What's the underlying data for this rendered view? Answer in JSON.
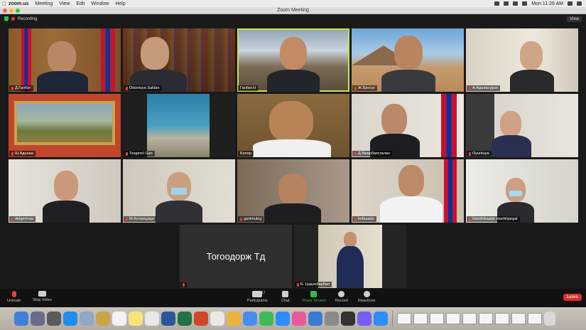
{
  "menubar": {
    "app": "zoom.us",
    "items": [
      "Meeting",
      "View",
      "Edit",
      "Window",
      "Help"
    ],
    "clock": "Mon 11:26 AM"
  },
  "window": {
    "title": "Zoom Meeting"
  },
  "meeting": {
    "recording_label": "Recording",
    "view_label": "View"
  },
  "participants": [
    "Д.Ганбат",
    "Odontuya Saldan",
    "Ганбат.Н",
    "Ж.Батсүх",
    "А.Адъяасүрэн",
    "Ш.Адъяаа",
    "Tsogerel Gan",
    "Болор",
    "Д.Амарбаясгалан",
    "Oyuntuya",
    "delgermaa",
    "М.Алтанцэцэг",
    "gankhuleg",
    "bolbaatar",
    "Gandnbaatar munkhjargal",
    "Тогоодорж Тд",
    "Б. Цэдэнбарбал"
  ],
  "toolbar": {
    "unmute": "Unmute",
    "stop_video": "Stop Video",
    "participants": "Participants",
    "participants_count": "17",
    "chat": "Chat",
    "share_screen": "Share Screen",
    "record": "Record",
    "reactions": "Reactions",
    "leave": "Leave"
  },
  "colors": {
    "active_speaker": "#c9e64a",
    "leave": "#d9302c",
    "share_screen": "#2fbd4f"
  }
}
